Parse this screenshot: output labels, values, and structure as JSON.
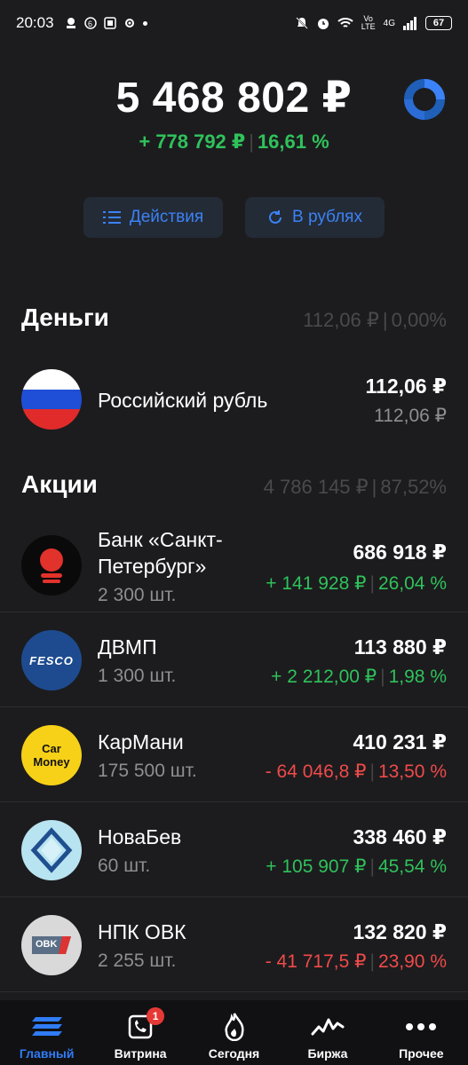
{
  "status_bar": {
    "time": "20:03",
    "network": "Vo LTE",
    "signal": "4G",
    "battery": "67"
  },
  "portfolio": {
    "total": "5 468 802 ₽",
    "change_abs": "+ 778 792 ₽",
    "change_pct": "16,61 %"
  },
  "buttons": {
    "actions": "Действия",
    "rubles": "В рублях"
  },
  "money": {
    "title": "Деньги",
    "sum": "112,06 ₽",
    "pct": "0,00%",
    "items": [
      {
        "name": "Российский рубль",
        "value": "112,06 ₽",
        "sub": "112,06 ₽"
      }
    ]
  },
  "stocks": {
    "title": "Акции",
    "sum": "4 786 145 ₽",
    "pct": "87,52%",
    "items": [
      {
        "name_line1": "Банк «Санкт-",
        "name_line2": "Петербург»",
        "qty": "2 300 шт.",
        "value": "686 918 ₽",
        "delta_abs": "+ 141 928 ₽",
        "delta_pct": "26,04 %",
        "logo": "bspb-logo"
      },
      {
        "name": "ДВМП",
        "qty": "1 300 шт.",
        "value": "113 880 ₽",
        "delta_abs": "+ 2 212,00 ₽",
        "delta_pct": "1,98 %",
        "logo": "fesco-logo",
        "logo_text": "FESCO"
      },
      {
        "name": "КарМани",
        "qty": "175 500 шт.",
        "value": "410 231 ₽",
        "delta_abs": "- 64 046,8 ₽",
        "delta_pct": "13,50 %",
        "logo": "carmoney-logo",
        "logo_text1": "Car",
        "logo_text2": "Money"
      },
      {
        "name": "НоваБев",
        "qty": "60 шт.",
        "value": "338 460 ₽",
        "delta_abs": "+ 105 907 ₽",
        "delta_pct": "45,54 %",
        "logo": "novabev-logo"
      },
      {
        "name": "НПК ОВК",
        "qty": "2 255 шт.",
        "value": "132 820 ₽",
        "delta_abs": "- 41 717,5 ₽",
        "delta_pct": "23,90 %",
        "logo": "ovk-logo",
        "logo_text": "OBK"
      }
    ]
  },
  "nav": [
    {
      "label": "Главный",
      "icon": "home-stack-icon"
    },
    {
      "label": "Витрина",
      "icon": "showcase-icon",
      "badge": "1"
    },
    {
      "label": "Сегодня",
      "icon": "flame-icon"
    },
    {
      "label": "Биржа",
      "icon": "pulse-icon"
    },
    {
      "label": "Прочее",
      "icon": "more-dots-icon"
    }
  ],
  "colors": {
    "background": "#1c1c1e",
    "positive": "#2fc25b",
    "negative": "#f04a4a",
    "accent": "#3b82f6"
  }
}
